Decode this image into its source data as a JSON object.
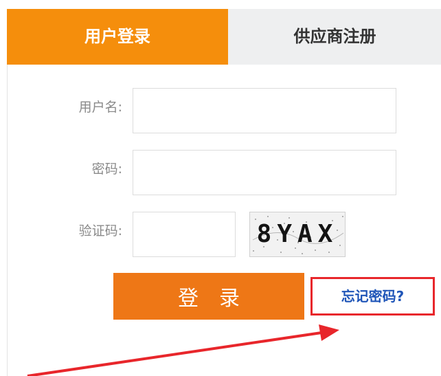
{
  "tabs": {
    "login": "用户登录",
    "register": "供应商注册"
  },
  "form": {
    "username_label": "用户名:",
    "username_value": "",
    "password_label": "密码:",
    "password_value": "",
    "captcha_label": "验证码:",
    "captcha_value": "",
    "captcha_text": "8YAX"
  },
  "actions": {
    "login_label": "登　录",
    "forgot_label": "忘记密码?"
  },
  "colors": {
    "active_tab": "#f58e0c",
    "login_button": "#ee7716",
    "forgot_link": "#1f55b8",
    "highlight_box": "#e8262b"
  }
}
